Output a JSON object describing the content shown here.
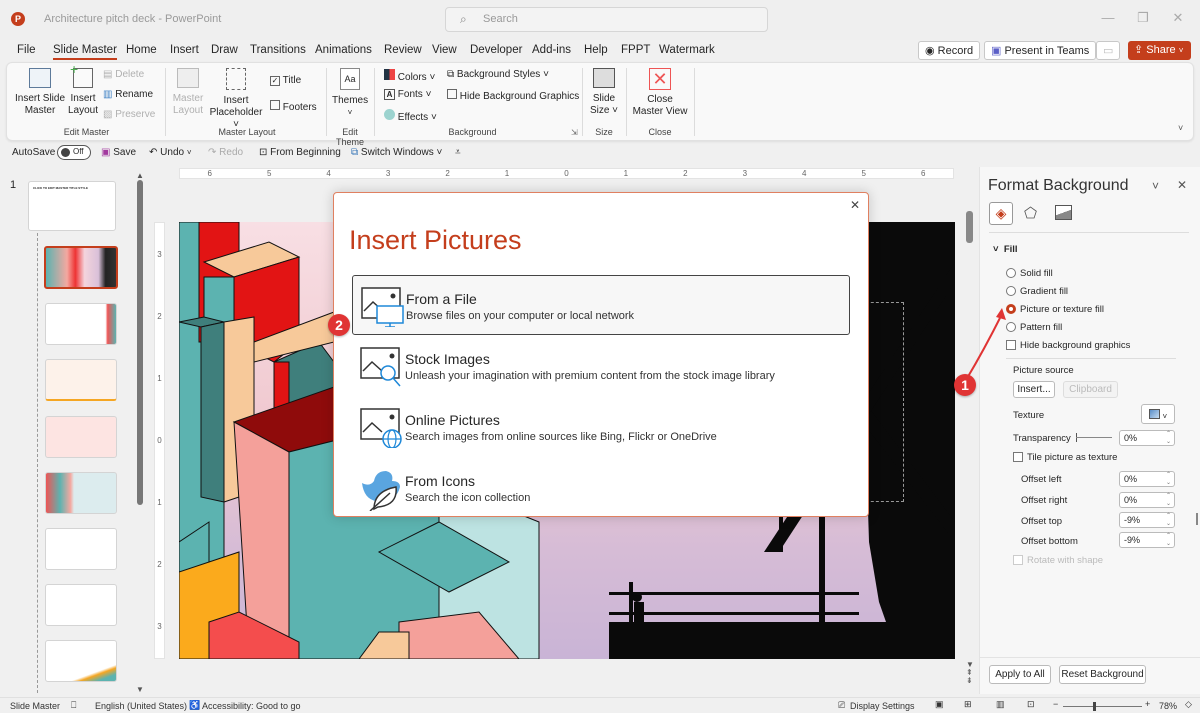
{
  "app": {
    "title": "Architecture pitch deck  -  PowerPoint",
    "logo": "P"
  },
  "search": {
    "placeholder": "Search"
  },
  "window": {
    "minimize": "—",
    "restore": "❐",
    "close": "✕"
  },
  "tabs": [
    "File",
    "Slide Master",
    "Home",
    "Insert",
    "Draw",
    "Transitions",
    "Animations",
    "Review",
    "View",
    "Developer",
    "Add-ins",
    "Help",
    "FPPT",
    "Watermark"
  ],
  "active_tab": "Slide Master",
  "top_buttons": {
    "record": "Record",
    "present_teams": "Present in Teams",
    "share": "Share"
  },
  "ribbon": {
    "edit_master": {
      "label": "Edit Master",
      "insert_slide_master": [
        "Insert Slide",
        "Master"
      ],
      "insert_layout": [
        "Insert",
        "Layout"
      ],
      "delete": "Delete",
      "rename": "Rename",
      "preserve": "Preserve"
    },
    "master_layout": {
      "label": "Master Layout",
      "master_layout": [
        "Master",
        "Layout"
      ],
      "insert_placeholder": [
        "Insert",
        "Placeholder ˅"
      ],
      "title": "Title",
      "title_checked": true,
      "footers": "Footers",
      "footers_checked": false
    },
    "edit_theme": {
      "label": "Edit Theme",
      "themes": "Themes"
    },
    "background": {
      "label": "Background",
      "colors": "Colors ˅",
      "fonts": "Fonts ˅",
      "effects": "Effects ˅",
      "background_styles": "Background Styles ˅",
      "hide_bg_graphics": "Hide Background Graphics"
    },
    "size": {
      "label": "Size",
      "slide_size": [
        "Slide",
        "Size ˅"
      ]
    },
    "close": {
      "label": "Close",
      "close_master_view": [
        "Close",
        "Master View"
      ]
    }
  },
  "qat": {
    "autosave": "AutoSave",
    "autosave_state": "Off",
    "save": "Save",
    "undo": "Undo",
    "redo": "Redo",
    "from_beginning": "From Beginning",
    "switch_windows": "Switch Windows ˅"
  },
  "slide_pane": {
    "master_number": "1",
    "thumb_count": 9,
    "selected_index": 1
  },
  "ruler": {
    "h_ticks": [
      "6",
      "5",
      "4",
      "3",
      "2",
      "1",
      "0",
      "1",
      "2",
      "3",
      "4",
      "5",
      "6"
    ],
    "v_ticks": [
      "3",
      "2",
      "1",
      "0",
      "1",
      "2",
      "3"
    ]
  },
  "dialog": {
    "title": "Insert Pictures",
    "close": "✕",
    "options": [
      {
        "title": "From a File",
        "desc": "Browse files on your computer or local network",
        "icon": "picture-computer-icon"
      },
      {
        "title": "Stock Images",
        "desc": "Unleash your imagination with premium content from the stock image library",
        "icon": "picture-search-icon"
      },
      {
        "title": "Online Pictures",
        "desc": "Search images from online sources like Bing, Flickr or OneDrive",
        "icon": "picture-globe-icon"
      },
      {
        "title": "From Icons",
        "desc": "Search the icon collection",
        "icon": "bird-leaf-icon"
      }
    ],
    "selected_option": 0
  },
  "annotations": {
    "step1": "1",
    "step2": "2"
  },
  "format_pane": {
    "title": "Format Background",
    "section": "Fill",
    "fill_options": [
      "Solid fill",
      "Gradient fill",
      "Picture or texture fill",
      "Pattern fill"
    ],
    "selected_fill": 2,
    "hide_bg_graphics": "Hide background graphics",
    "picture_source": "Picture source",
    "insert_btn": "Insert...",
    "clipboard_btn": "Clipboard",
    "texture": "Texture",
    "transparency": "Transparency",
    "transparency_value": "0%",
    "tile": "Tile picture as texture",
    "offsets": [
      {
        "label": "Offset left",
        "value": "0%"
      },
      {
        "label": "Offset right",
        "value": "0%"
      },
      {
        "label": "Offset top",
        "value": "-9%"
      },
      {
        "label": "Offset bottom",
        "value": "-9%"
      }
    ],
    "rotate": "Rotate with shape",
    "apply_all": "Apply to All",
    "reset": "Reset Background"
  },
  "status": {
    "view": "Slide Master",
    "language": "English (United States)",
    "accessibility": "Accessibility: Good to go",
    "display_settings": "Display Settings",
    "zoom": "78%",
    "zoom_fraction": 0.39
  },
  "colors": {
    "accent": "#c43e1c",
    "badge": "#e03434",
    "link_blue": "#1e88d8"
  }
}
